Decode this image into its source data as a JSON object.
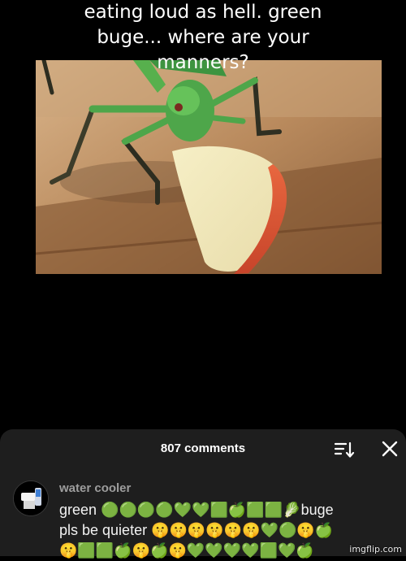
{
  "caption": {
    "line1": "eating loud as hell. green",
    "line2": "buge... where are your",
    "line3": "manners?"
  },
  "video": {
    "description_icon": "grasshopper-eating-apple-image"
  },
  "comments_sheet": {
    "count_label": "807 comments",
    "sort_icon": "sort-icon",
    "close_icon": "close-icon"
  },
  "comment": {
    "username": "water cooler",
    "avatar_icon": "water-cooler-avatar-icon",
    "line1": "green 🟢🟢🟢🟢💚💚🟩🍏🟩🟩🥬buge",
    "line2": "pls be quieter 🤫🤫🤫🤫🤫🤫💚🟢🤫🍏",
    "line3": "🤫🟩🟩🍏🤫🍏🤫💚💚💚💚🟩💚🍏"
  },
  "watermark": "imgflip.com",
  "colors": {
    "background": "#000000",
    "sheet": "#1e1e1e",
    "username": "#9d9d9d",
    "text": "#f2f2f2"
  }
}
